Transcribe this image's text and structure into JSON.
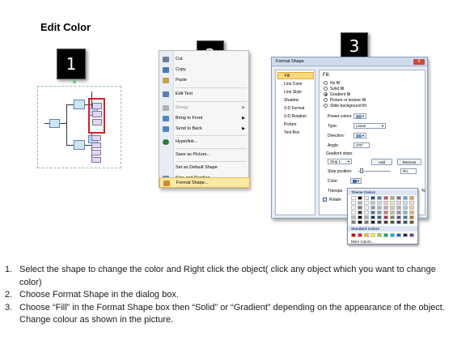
{
  "title": "Edit Color",
  "steps": [
    "1",
    "2",
    "3"
  ],
  "menu": {
    "items": [
      {
        "label": "Cut",
        "state": "enabled",
        "icon": "scissors-icon",
        "color": "#6b7fa0"
      },
      {
        "label": "Copy",
        "state": "enabled",
        "icon": "copy-icon",
        "color": "#4b78b5"
      },
      {
        "label": "Paste",
        "state": "enabled",
        "icon": "paste-icon",
        "color": "#c8a050"
      },
      {
        "label": "Edit Text",
        "state": "enabled",
        "icon": "edit-text-icon",
        "color": "#5a7fb0"
      },
      {
        "label": "Group",
        "state": "disabled",
        "icon": "group-icon",
        "color": "#b0b0b0"
      },
      {
        "label": "Bring to Front",
        "state": "enabled",
        "icon": "bring-front-icon",
        "color": "#4e86c4"
      },
      {
        "label": "Send to Back",
        "state": "enabled",
        "icon": "send-back-icon",
        "color": "#4e86c4"
      },
      {
        "label": "Hyperlink...",
        "state": "enabled",
        "icon": "hyperlink-icon",
        "color": "#2f7a3d"
      },
      {
        "label": "Save as Picture...",
        "state": "enabled",
        "icon": "none",
        "color": ""
      },
      {
        "label": "Set as Default Shape",
        "state": "enabled",
        "icon": "none",
        "color": ""
      },
      {
        "label": "Size and Position...",
        "state": "enabled",
        "icon": "size-position-icon",
        "color": "#6d8ab4"
      },
      {
        "label": "Format Shape...",
        "state": "highlighted",
        "icon": "format-shape-icon",
        "color": "#d08a2c"
      }
    ]
  },
  "dialog": {
    "title": "Format Shape",
    "close": "X",
    "sidebar": [
      "Fill",
      "Line Color",
      "Line Style",
      "Shadow",
      "3-D Format",
      "3-D Rotation",
      "Picture",
      "Text Box"
    ],
    "section": "Fill",
    "fill_options": [
      "No fill",
      "Solid fill",
      "Gradient fill",
      "Picture or texture fill",
      "Slide background fill"
    ],
    "selected_fill": "Gradient fill",
    "preset_label": "Preset colors:",
    "type_label": "Type:",
    "type_value": "Linear",
    "direction_label": "Direction:",
    "angle_label": "Angle:",
    "angle_value": "270°",
    "stops_label": "Gradient stops",
    "stop_value": "Stop 1",
    "add": "Add",
    "remove": "Remove",
    "stop_pos_label": "Stop position:",
    "stop_pos_value": "0%",
    "color_label": "Color:",
    "transparency_label": "Transpa",
    "rotate_label": "Rotate",
    "percent": "%"
  },
  "palette": {
    "theme_label": "Theme Colors",
    "standard_label": "Standard Colors",
    "more": "More Colors...",
    "theme_top": [
      "#ffffff",
      "#000000",
      "#eeece1",
      "#1f497d",
      "#4f81bd",
      "#c0504d",
      "#9bbb59",
      "#8064a2",
      "#4bacc6",
      "#f79646"
    ],
    "standard": [
      "#c00000",
      "#ff0000",
      "#ffc000",
      "#ffff00",
      "#92d050",
      "#00b050",
      "#00b0f0",
      "#0070c0",
      "#002060",
      "#7030a0"
    ]
  },
  "instructions": [
    {
      "n": "1.",
      "text": "Select the shape to change the color and Right click the object( click any object which you want to change color)"
    },
    {
      "n": "2.",
      "text": "Choose Format Shape in the dialog box."
    },
    {
      "n": "3.",
      "text": "Choose “Fill” in the Format Shape box then “Solid” or “Gradient” depending on the appearance of the object. Change colour as shown in the picture."
    }
  ]
}
